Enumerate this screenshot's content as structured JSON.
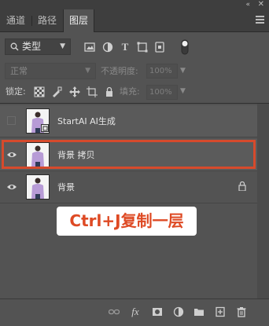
{
  "tabs": [
    {
      "label": "通道"
    },
    {
      "label": "路径"
    },
    {
      "label": "图层",
      "active": true
    }
  ],
  "window": {
    "collapse_glyph": "«",
    "close_glyph": "✕"
  },
  "filter": {
    "kind_label": "类型"
  },
  "blend": {
    "mode": "正常",
    "opacity_label": "不透明度:",
    "opacity_value": "100%"
  },
  "lock": {
    "label": "锁定:",
    "fill_label": "填充:",
    "fill_value": "100%"
  },
  "layers": [
    {
      "name": "StartAI AI生成",
      "visible": false
    },
    {
      "name": "背景 拷贝",
      "visible": true,
      "selected": true
    },
    {
      "name": "背景",
      "visible": true,
      "locked": true
    }
  ],
  "callout": {
    "text": "Ctrl+J复制一层"
  },
  "colors": {
    "accent": "#d64a2c",
    "callout_text": "#de4a24",
    "panel_bg": "#535353"
  }
}
